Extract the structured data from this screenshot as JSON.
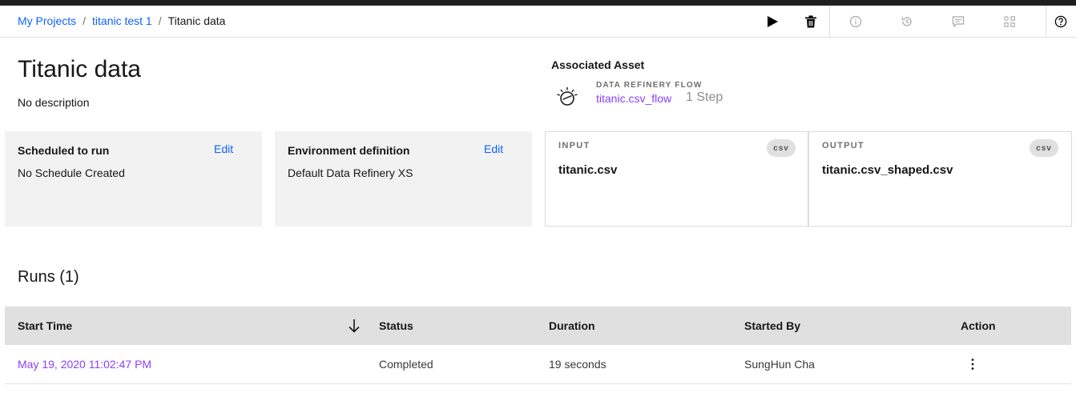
{
  "breadcrumb": {
    "items": [
      "My Projects",
      "titanic test 1"
    ],
    "current": "Titanic data"
  },
  "toolbar": {
    "icons": [
      "play-icon",
      "trash-icon",
      "info-icon",
      "history-icon",
      "comment-icon",
      "grid-icon",
      "help-icon"
    ]
  },
  "job": {
    "title": "Titanic data",
    "description": "No description"
  },
  "associated_asset": {
    "heading": "Associated Asset",
    "type": "DATA REFINERY FLOW",
    "name": "titanic.csv_flow",
    "steps": "1 Step"
  },
  "schedule": {
    "title": "Scheduled to run",
    "edit": "Edit",
    "value": "No Schedule Created"
  },
  "environment": {
    "title": "Environment definition",
    "edit": "Edit",
    "value": "Default Data Refinery XS"
  },
  "input": {
    "label": "INPUT",
    "badge": "csv",
    "file": "titanic.csv"
  },
  "output": {
    "label": "OUTPUT",
    "badge": "csv",
    "file": "titanic.csv_shaped.csv"
  },
  "runs": {
    "heading": "Runs (1)",
    "columns": [
      "Start Time",
      "Status",
      "Duration",
      "Started By",
      "Action"
    ],
    "rows": [
      {
        "start_time": "May 19, 2020 11:02:47 PM",
        "status": "Completed",
        "duration": "19 seconds",
        "started_by": "SungHun Cha"
      }
    ]
  },
  "colors": {
    "link": "#0f62fe",
    "visited_link": "#8a3ffc",
    "tile_bg": "#f2f2f2",
    "table_header_bg": "#e0e0e0"
  }
}
